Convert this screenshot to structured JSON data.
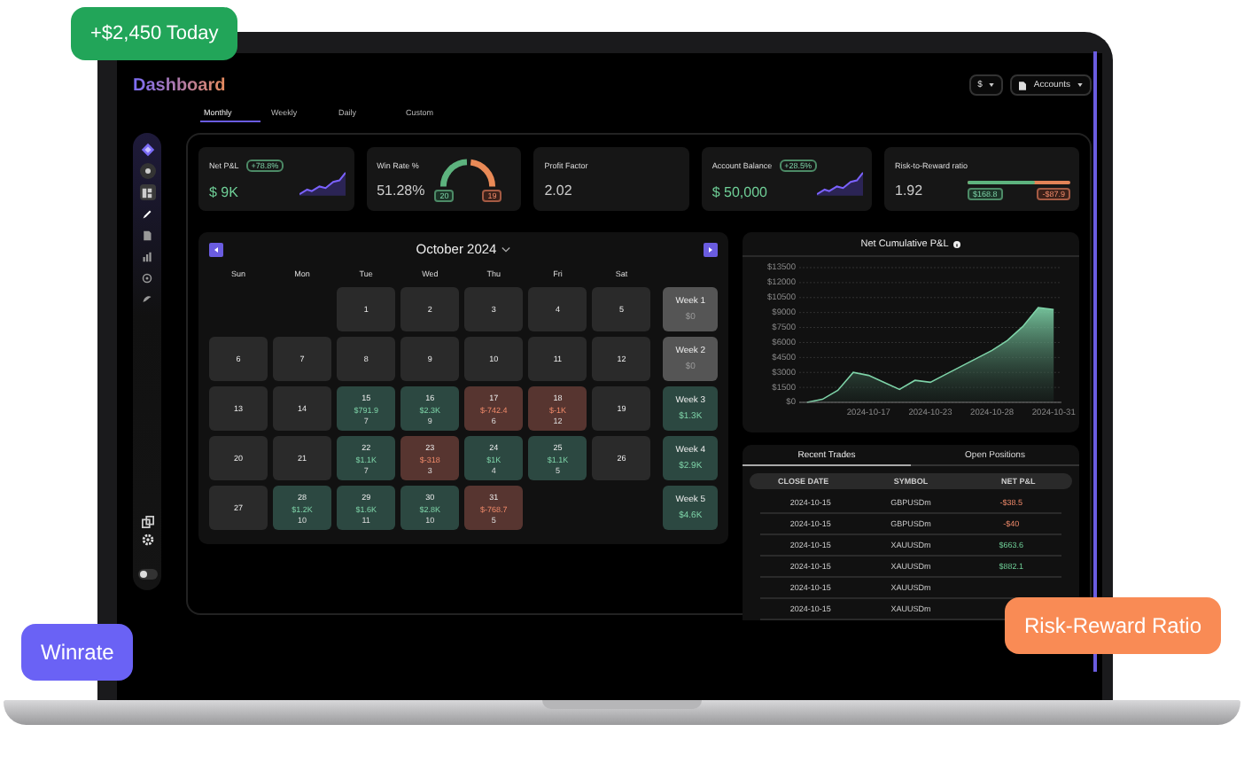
{
  "badges": [
    {
      "text": "+$2,450 Today",
      "color": "#22a559"
    },
    {
      "text": "Winrate",
      "color": "#6a62f5"
    },
    {
      "text": "Risk-Reward Ratio",
      "color": "#f98b55"
    }
  ],
  "header": {
    "title": "Dashboard",
    "currency": "$",
    "accounts": "Accounts"
  },
  "theme_toggle": {
    "on": false
  },
  "tabs": [
    {
      "label": "Monthly",
      "selected": true
    },
    {
      "label": "Weekly",
      "selected": false
    },
    {
      "label": "Daily",
      "selected": false
    },
    {
      "label": "Custom",
      "selected": false
    }
  ],
  "sidebar": {
    "nav": [
      {
        "selected": true
      },
      {
        "selected": false
      },
      {
        "selected": false
      },
      {
        "selected": false
      },
      {
        "selected": false
      },
      {
        "selected": false
      }
    ]
  },
  "stats": [
    {
      "kind": "sparkline",
      "label": "Net P&L",
      "badge": "+78.8%",
      "value": "$ 9K"
    },
    {
      "kind": "gauge",
      "label": "Win Rate %",
      "value": "51.28%",
      "wins": "20",
      "losses": "19"
    },
    {
      "kind": "plain",
      "label": "Profit Factor",
      "value": "2.02"
    },
    {
      "kind": "sparkline",
      "label": "Account Balance",
      "badge": "+28.5%",
      "value": "$ 50,000"
    },
    {
      "kind": "ratio",
      "label": "Risk-to-Reward ratio",
      "value": "1.92",
      "gain": "$168.8",
      "loss": "-$87.9",
      "level": 0.66
    }
  ],
  "calendar": {
    "month": "October 2024",
    "weekdays": [
      "Sun",
      "Mon",
      "Tue",
      "Wed",
      "Thu",
      "Fri",
      "Sat"
    ],
    "weeks": [
      {
        "days": [
          {
            "kind": "empty"
          },
          {
            "kind": "empty"
          },
          {
            "kind": "flat",
            "day": "1"
          },
          {
            "kind": "flat",
            "day": "2"
          },
          {
            "kind": "flat",
            "day": "3"
          },
          {
            "kind": "flat",
            "day": "4"
          },
          {
            "kind": "flat",
            "day": "5"
          }
        ],
        "summary": {
          "label": "Week 1",
          "value": "$0",
          "kind": "flat"
        }
      },
      {
        "days": [
          {
            "kind": "flat",
            "day": "6"
          },
          {
            "kind": "flat",
            "day": "7"
          },
          {
            "kind": "flat",
            "day": "8"
          },
          {
            "kind": "flat",
            "day": "9"
          },
          {
            "kind": "flat",
            "day": "10"
          },
          {
            "kind": "flat",
            "day": "11"
          },
          {
            "kind": "flat",
            "day": "12"
          }
        ],
        "summary": {
          "label": "Week 2",
          "value": "$0",
          "kind": "flat"
        }
      },
      {
        "days": [
          {
            "kind": "flat",
            "day": "13"
          },
          {
            "kind": "flat",
            "day": "14"
          },
          {
            "kind": "profit",
            "day": "15",
            "pnl": "$791.9",
            "trades": "7"
          },
          {
            "kind": "profit",
            "day": "16",
            "pnl": "$2.3K",
            "trades": "9"
          },
          {
            "kind": "loss",
            "day": "17",
            "pnl": "$-742.4",
            "trades": "6"
          },
          {
            "kind": "loss",
            "day": "18",
            "pnl": "$-1K",
            "trades": "12"
          },
          {
            "kind": "flat",
            "day": "19"
          }
        ],
        "summary": {
          "label": "Week 3",
          "value": "$1.3K",
          "kind": "profit"
        }
      },
      {
        "days": [
          {
            "kind": "flat",
            "day": "20"
          },
          {
            "kind": "flat",
            "day": "21"
          },
          {
            "kind": "profit",
            "day": "22",
            "pnl": "$1.1K",
            "trades": "7"
          },
          {
            "kind": "loss",
            "day": "23",
            "pnl": "$-318",
            "trades": "3"
          },
          {
            "kind": "profit",
            "day": "24",
            "pnl": "$1K",
            "trades": "4"
          },
          {
            "kind": "profit",
            "day": "25",
            "pnl": "$1.1K",
            "trades": "5"
          },
          {
            "kind": "flat",
            "day": "26"
          }
        ],
        "summary": {
          "label": "Week 4",
          "value": "$2.9K",
          "kind": "profit"
        }
      },
      {
        "days": [
          {
            "kind": "flat",
            "day": "27"
          },
          {
            "kind": "profit",
            "day": "28",
            "pnl": "$1.2K",
            "trades": "10"
          },
          {
            "kind": "profit",
            "day": "29",
            "pnl": "$1.6K",
            "trades": "11"
          },
          {
            "kind": "profit",
            "day": "30",
            "pnl": "$2.8K",
            "trades": "10"
          },
          {
            "kind": "loss",
            "day": "31",
            "pnl": "$-768.7",
            "trades": "5"
          },
          {
            "kind": "empty"
          },
          {
            "kind": "empty"
          }
        ],
        "summary": {
          "label": "Week 5",
          "value": "$4.6K",
          "kind": "profit"
        }
      }
    ]
  },
  "cumulative": {
    "title": "Net Cumulative P&L",
    "chart_data": {
      "type": "area",
      "categories": [
        null,
        null,
        null,
        null,
        "2024-10-17",
        null,
        null,
        null,
        "2024-10-23",
        null,
        null,
        null,
        "2024-10-28",
        null,
        null,
        null,
        "2024-10-31"
      ],
      "series": [
        {
          "color": "#7ed3a8",
          "values": [
            0,
            300,
            1200,
            3000,
            2700,
            2000,
            1300,
            2200,
            2000,
            2800,
            3600,
            4400,
            5200,
            6200,
            7600,
            9500,
            9300
          ]
        }
      ],
      "grid": true,
      "ylim": [
        0,
        13500
      ],
      "yticks": [
        {
          "value": 0,
          "label": "$0"
        },
        {
          "value": 1500,
          "label": "$1500"
        },
        {
          "value": 3000,
          "label": "$3000"
        },
        {
          "value": 4500,
          "label": "$4500"
        },
        {
          "value": 6000,
          "label": "$6000"
        },
        {
          "value": 7500,
          "label": "$7500"
        },
        {
          "value": 9000,
          "label": "$9000"
        },
        {
          "value": 10500,
          "label": "$10500"
        },
        {
          "value": 12000,
          "label": "$12000"
        },
        {
          "value": 13500,
          "label": "$13500"
        }
      ]
    }
  },
  "trades": {
    "tabs": [
      {
        "label": "Recent Trades",
        "selected": true
      },
      {
        "label": "Open Positions",
        "selected": false
      }
    ],
    "columns": [
      "CLOSE DATE",
      "SYMBOL",
      "NET P&L"
    ],
    "rows": [
      {
        "date": "2024-10-15",
        "symbol": "GBPUSDm",
        "pnl": "-$38.5",
        "kind": "loss"
      },
      {
        "date": "2024-10-15",
        "symbol": "GBPUSDm",
        "pnl": "-$40",
        "kind": "loss"
      },
      {
        "date": "2024-10-15",
        "symbol": "XAUUSDm",
        "pnl": "$663.6",
        "kind": "profit"
      },
      {
        "date": "2024-10-15",
        "symbol": "XAUUSDm",
        "pnl": "$882.1",
        "kind": "profit"
      },
      {
        "date": "2024-10-15",
        "symbol": "XAUUSDm"
      },
      {
        "date": "2024-10-15",
        "symbol": "XAUUSDm"
      }
    ]
  }
}
